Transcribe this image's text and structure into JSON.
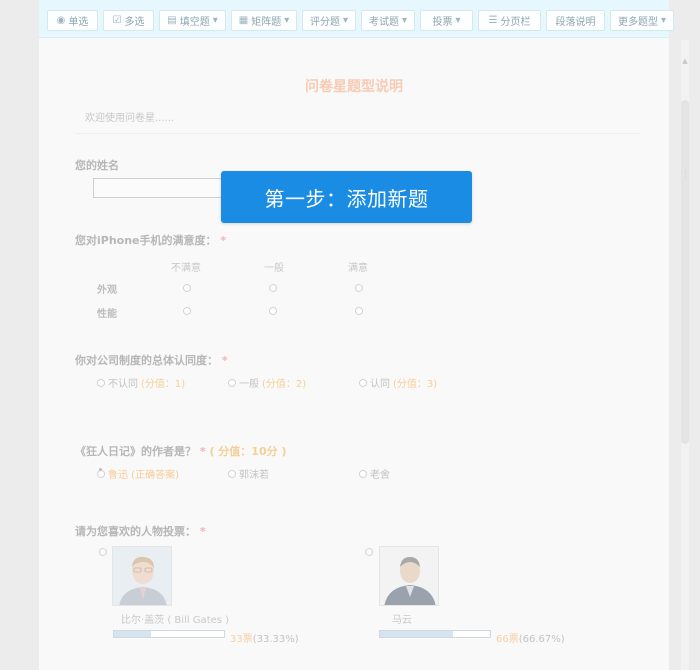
{
  "toolbar": {
    "buttons": [
      {
        "label": "单选",
        "icon": "radio-icon",
        "dropdown": false
      },
      {
        "label": "多选",
        "icon": "checkbox-icon",
        "dropdown": false
      },
      {
        "label": "填空题",
        "icon": "text-field-icon",
        "dropdown": true
      },
      {
        "label": "矩阵题",
        "icon": "matrix-icon",
        "dropdown": true
      },
      {
        "label": "评分题",
        "icon": "",
        "dropdown": true
      },
      {
        "label": "考试题",
        "icon": "",
        "dropdown": true
      },
      {
        "label": "投票",
        "icon": "",
        "dropdown": true
      },
      {
        "label": "分页栏",
        "icon": "page-break-icon",
        "dropdown": false
      },
      {
        "label": "段落说明",
        "icon": "",
        "dropdown": false
      },
      {
        "label": "更多题型",
        "icon": "",
        "dropdown": true
      }
    ]
  },
  "survey": {
    "title": "问卷星题型说明",
    "welcome": "欢迎使用问卷星......"
  },
  "q1": {
    "title": "您的姓名"
  },
  "q2": {
    "title": "您对iPhone手机的满意度：",
    "required": "*",
    "columns": [
      "不满意",
      "一般",
      "满意"
    ],
    "rows": [
      "外观",
      "性能"
    ]
  },
  "q3": {
    "title": "你对公司制度的总体认同度：",
    "required": "*",
    "options": [
      {
        "label": "不认同",
        "score": "(分值：1)"
      },
      {
        "label": "一般",
        "score": "(分值：2)"
      },
      {
        "label": "认同",
        "score": "(分值：3)"
      }
    ]
  },
  "q4": {
    "title": "《狂人日记》的作者是？",
    "required": "*",
    "score": "( 分值：10分 )",
    "options": [
      "鲁迅 (正确答案)",
      "郭沫若",
      "老舍"
    ],
    "selected_index": 0
  },
  "q5": {
    "title": "请为您喜欢的人物投票：",
    "required": "*",
    "candidates": [
      {
        "name": "比尔·盖茨 ( Bill Gates )",
        "votes": "33票",
        "percent": "(33.33%)",
        "share": 0.3333
      },
      {
        "name": "马云",
        "votes": "66票",
        "percent": "(66.67%)",
        "share": 0.6667
      }
    ]
  },
  "overlay": {
    "text": "第一步：添加新题"
  },
  "colors": {
    "toolbar_bg": "#e6f8fd",
    "overlay_bg": "#1a8ce3",
    "title": "#f7cbb4",
    "required": "#f4b3b3",
    "score": "#f5cf98"
  }
}
